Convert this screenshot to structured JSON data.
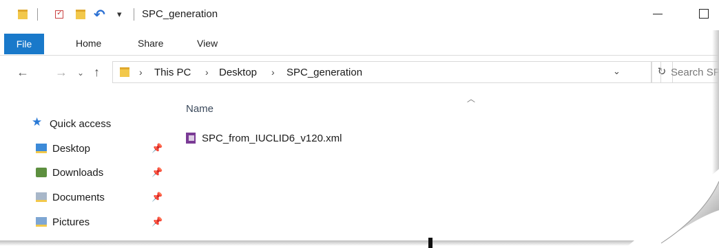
{
  "window": {
    "title": "SPC_generation"
  },
  "ribbon": {
    "tabs": [
      {
        "label": "File"
      },
      {
        "label": "Home"
      },
      {
        "label": "Share"
      },
      {
        "label": "View"
      }
    ]
  },
  "address": {
    "crumbs": [
      "This PC",
      "Desktop",
      "SPC_generation"
    ],
    "search_placeholder": "Search SP"
  },
  "nav_pane": {
    "quick_access": "Quick access",
    "items": [
      {
        "label": "Desktop",
        "icon": "desktop-folder-icon"
      },
      {
        "label": "Downloads",
        "icon": "downloads-folder-icon"
      },
      {
        "label": "Documents",
        "icon": "documents-folder-icon"
      },
      {
        "label": "Pictures",
        "icon": "pictures-folder-icon"
      }
    ]
  },
  "file_list": {
    "column_name": "Name",
    "files": [
      {
        "name": "SPC_from_IUCLID6_v120.xml",
        "icon": "xml-file-icon"
      }
    ]
  },
  "colors": {
    "file_tab": "#1979ca",
    "accent_blue": "#2a7ad6",
    "folder_yellow": "#f2c84b"
  }
}
